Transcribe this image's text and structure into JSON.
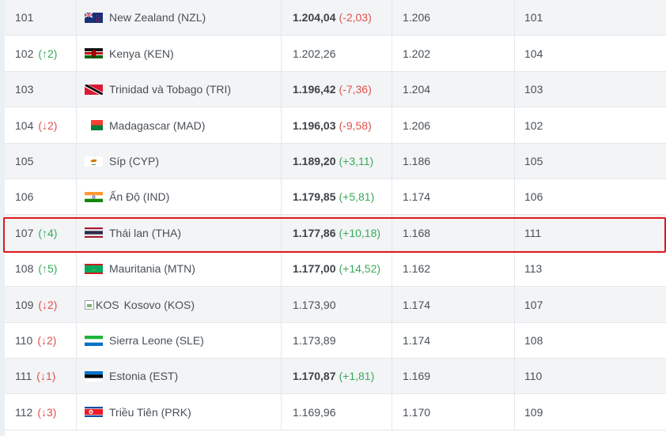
{
  "rows": [
    {
      "rank": "101",
      "move": "",
      "dir": "",
      "flag": "nzl",
      "team": "New Zealand (NZL)",
      "pts": "1.204,04",
      "chg": "(-2,03)",
      "chg_dir": "down",
      "bold": true,
      "prev": "1.206",
      "last": "101"
    },
    {
      "rank": "102",
      "move": "(↑2)",
      "dir": "up",
      "flag": "ken",
      "team": "Kenya (KEN)",
      "pts": "1.202,26",
      "chg": "",
      "chg_dir": "",
      "bold": false,
      "prev": "1.202",
      "last": "104"
    },
    {
      "rank": "103",
      "move": "",
      "dir": "",
      "flag": "tri",
      "team": "Trinidad và Tobago (TRI)",
      "pts": "1.196,42",
      "chg": "(-7,36)",
      "chg_dir": "down",
      "bold": true,
      "prev": "1.204",
      "last": "103"
    },
    {
      "rank": "104",
      "move": "(↓2)",
      "dir": "down",
      "flag": "mad",
      "team": "Madagascar (MAD)",
      "pts": "1.196,03",
      "chg": "(-9,58)",
      "chg_dir": "down",
      "bold": true,
      "prev": "1.206",
      "last": "102"
    },
    {
      "rank": "105",
      "move": "",
      "dir": "",
      "flag": "cyp",
      "team": "Síp (CYP)",
      "pts": "1.189,20",
      "chg": "(+3,11)",
      "chg_dir": "up",
      "bold": true,
      "prev": "1.186",
      "last": "105"
    },
    {
      "rank": "106",
      "move": "",
      "dir": "",
      "flag": "ind",
      "team": "Ấn Độ (IND)",
      "pts": "1.179,85",
      "chg": "(+5,81)",
      "chg_dir": "up",
      "bold": true,
      "prev": "1.174",
      "last": "106"
    },
    {
      "rank": "107",
      "move": "(↑4)",
      "dir": "up",
      "flag": "tha",
      "team": "Thái lan (THA)",
      "pts": "1.177,86",
      "chg": "(+10,18)",
      "chg_dir": "up",
      "bold": true,
      "prev": "1.168",
      "last": "111"
    },
    {
      "rank": "108",
      "move": "(↑5)",
      "dir": "up",
      "flag": "mtn",
      "team": "Mauritania (MTN)",
      "pts": "1.177,00",
      "chg": "(+14,52)",
      "chg_dir": "up",
      "bold": true,
      "prev": "1.162",
      "last": "113"
    },
    {
      "rank": "109",
      "move": "(↓2)",
      "dir": "down",
      "flag": "kos",
      "flag_alt": "KOS",
      "team": "Kosovo (KOS)",
      "pts": "1.173,90",
      "chg": "",
      "chg_dir": "",
      "bold": false,
      "prev": "1.174",
      "last": "107"
    },
    {
      "rank": "110",
      "move": "(↓2)",
      "dir": "down",
      "flag": "sle",
      "team": "Sierra Leone (SLE)",
      "pts": "1.173,89",
      "chg": "",
      "chg_dir": "",
      "bold": false,
      "prev": "1.174",
      "last": "108"
    },
    {
      "rank": "111",
      "move": "(↓1)",
      "dir": "down",
      "flag": "est",
      "team": "Estonia (EST)",
      "pts": "1.170,87",
      "chg": "(+1,81)",
      "chg_dir": "up",
      "bold": true,
      "prev": "1.169",
      "last": "110"
    },
    {
      "rank": "112",
      "move": "(↓3)",
      "dir": "down",
      "flag": "prk",
      "team": "Triều Tiên (PRK)",
      "pts": "1.169,96",
      "chg": "",
      "chg_dir": "",
      "bold": false,
      "prev": "1.170",
      "last": "109"
    }
  ],
  "highlighted_team": "Thái lan (THA)",
  "colors": {
    "up": "#3aaa5a",
    "down": "#e0514c",
    "highlight": "#e0181c"
  }
}
